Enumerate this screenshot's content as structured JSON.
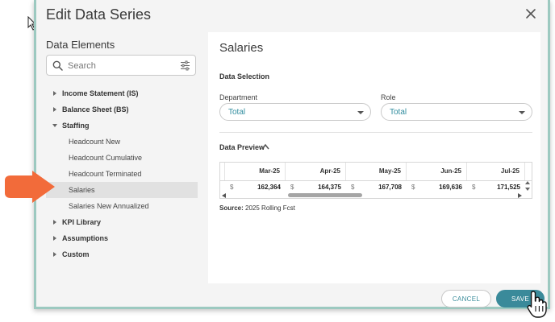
{
  "dialog": {
    "title": "Edit Data Series"
  },
  "left_pane": {
    "heading": "Data Elements",
    "search_placeholder": "Search",
    "tree": [
      {
        "label": "Income Statement (IS)",
        "type": "parent",
        "expanded": false
      },
      {
        "label": "Balance Sheet (BS)",
        "type": "parent",
        "expanded": false
      },
      {
        "label": "Staffing",
        "type": "parent",
        "expanded": true
      },
      {
        "label": "Headcount New",
        "type": "child"
      },
      {
        "label": "Headcount Cumulative",
        "type": "child"
      },
      {
        "label": "Headcount Terminated",
        "type": "child"
      },
      {
        "label": "Salaries",
        "type": "child",
        "selected": true
      },
      {
        "label": "Salaries New Annualized",
        "type": "child"
      },
      {
        "label": "KPI Library",
        "type": "parent",
        "expanded": false
      },
      {
        "label": "Assumptions",
        "type": "parent",
        "expanded": false
      },
      {
        "label": "Custom",
        "type": "parent",
        "expanded": false
      }
    ]
  },
  "right_pane": {
    "title": "Salaries",
    "data_selection_heading": "Data Selection",
    "department": {
      "label": "Department",
      "value": "Total"
    },
    "role": {
      "label": "Role",
      "value": "Total"
    },
    "data_preview_heading": "Data Preview",
    "grid": {
      "columns": [
        "Mar-25",
        "Apr-25",
        "May-25",
        "Jun-25",
        "Jul-25"
      ],
      "currency_symbol": "$",
      "values": [
        "162,364",
        "164,375",
        "167,708",
        "169,636",
        "171,525"
      ]
    },
    "source_label": "Source:",
    "source_value": "2025 Rolling Fcst"
  },
  "footer": {
    "cancel_label": "CANCEL",
    "save_label": "SAVE"
  },
  "colors": {
    "accent": "#3a8a9a",
    "dialog_border": "#9cc9c0",
    "arrow": "#f26b3a",
    "select_value": "#2f8c9e"
  }
}
